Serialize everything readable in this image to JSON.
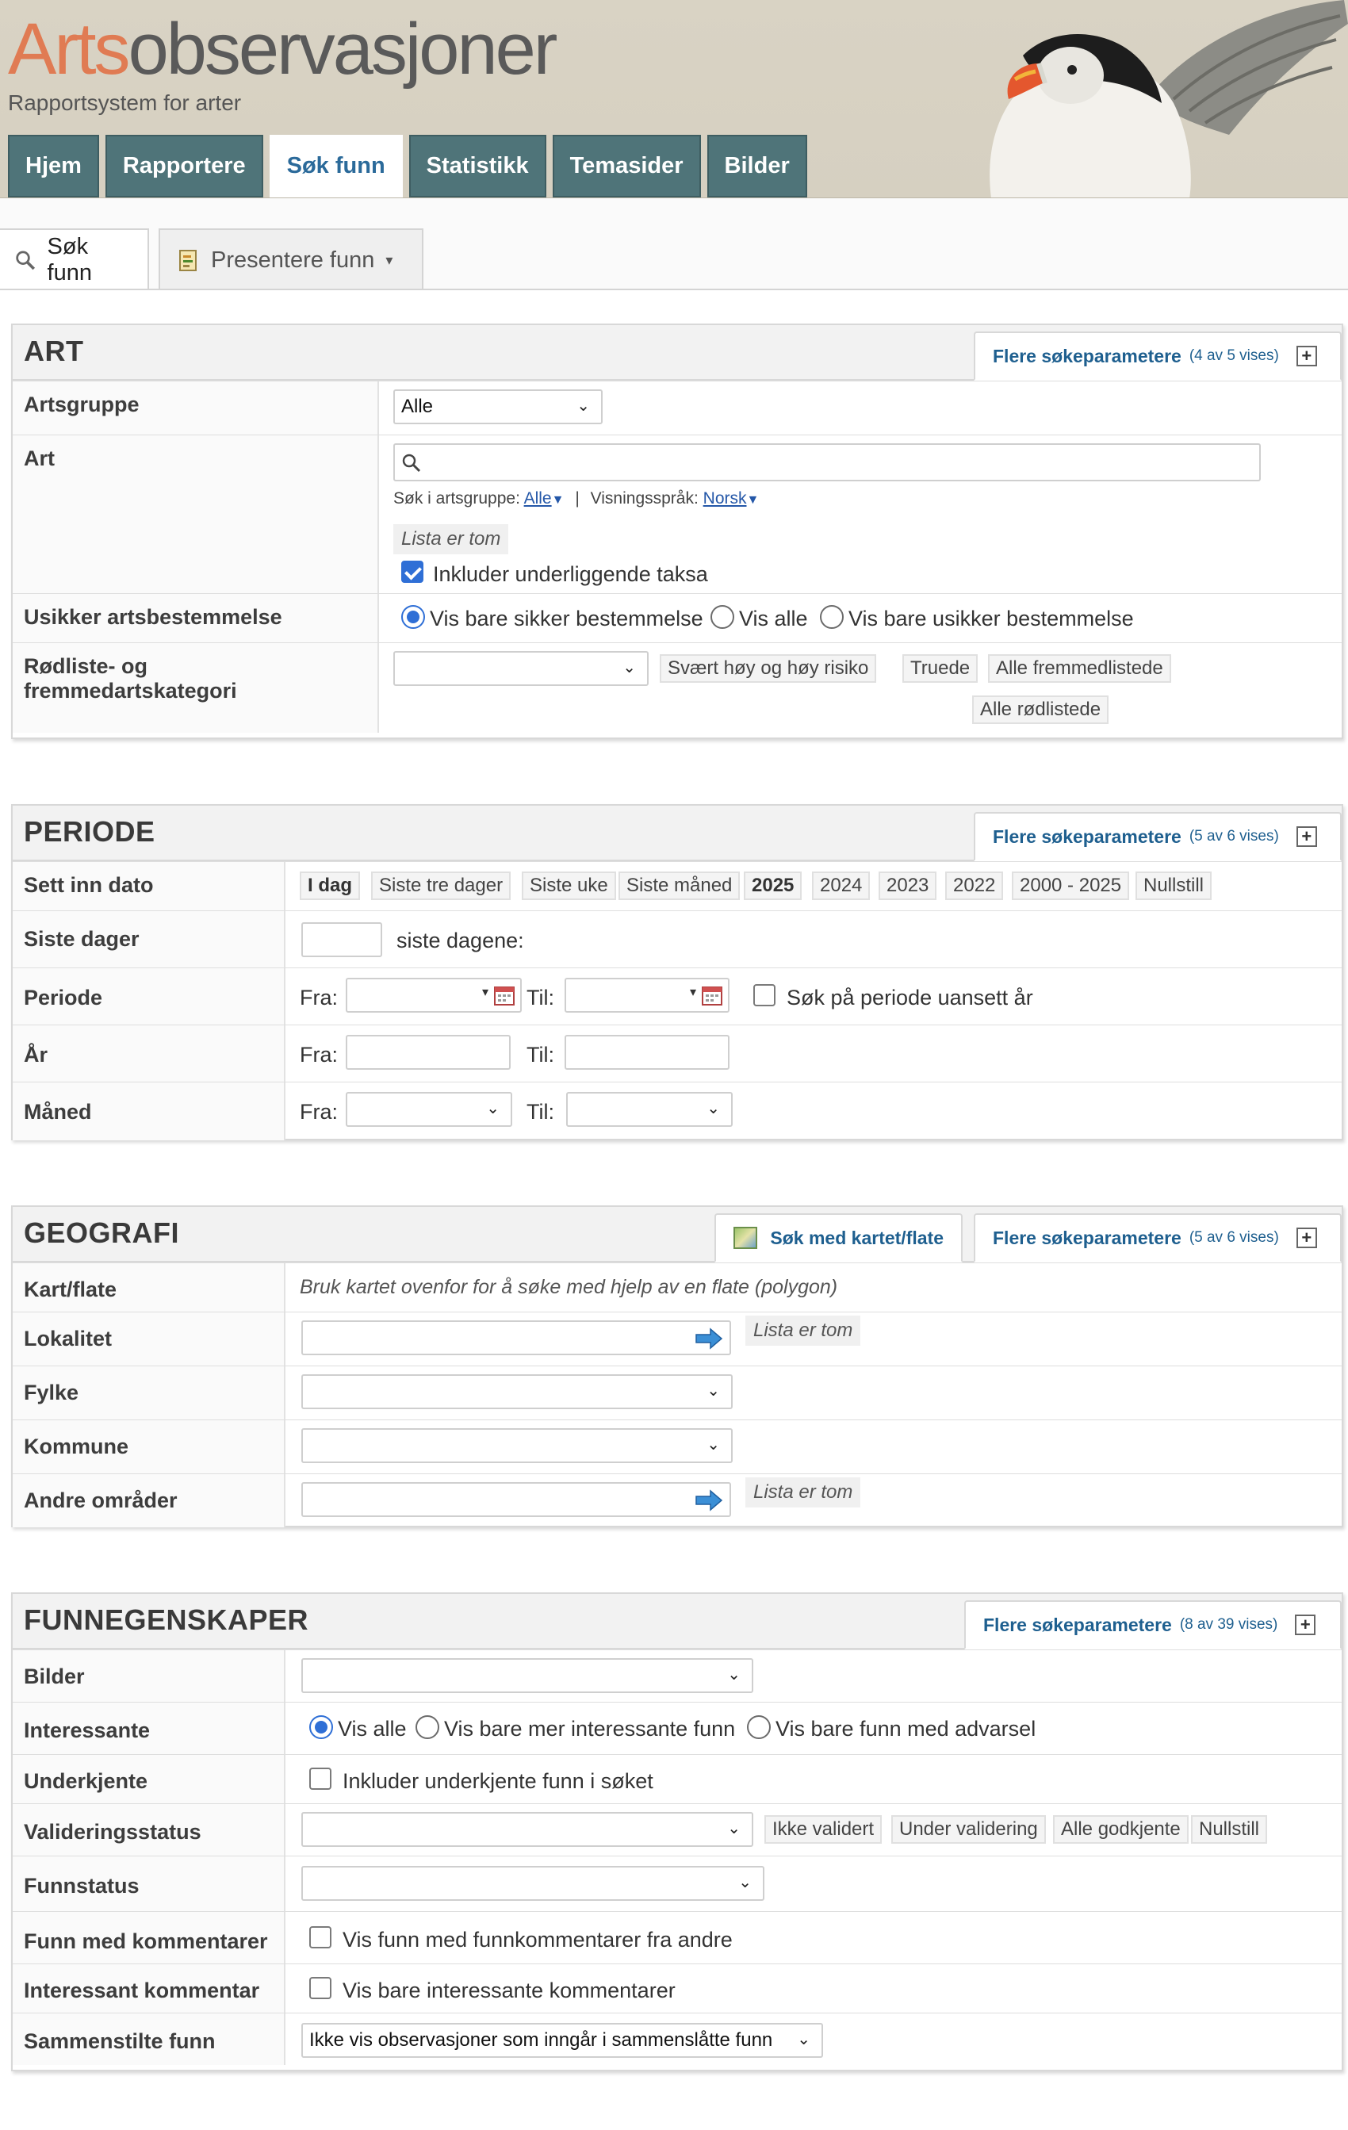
{
  "header": {
    "logo_arts": "Arts",
    "logo_obs": "observasjoner",
    "tagline": "Rapportsystem for arter",
    "nav": [
      "Hjem",
      "Rapportere",
      "Søk funn",
      "Statistikk",
      "Temasider",
      "Bilder"
    ],
    "nav_active": "Søk funn"
  },
  "subtabs": {
    "search": "Søk funn",
    "present": "Presentere funn"
  },
  "more_params_label": "Flere søkeparametere",
  "art": {
    "title": "ART",
    "more_count": "(4 av 5 vises)",
    "artsgruppe_label": "Artsgruppe",
    "artsgruppe_value": "Alle",
    "art_label": "Art",
    "search_in_group": "Søk i artsgruppe:",
    "search_in_group_value": "Alle",
    "display_lang": "Visningsspråk:",
    "display_lang_value": "Norsk",
    "list_empty": "Lista er tom",
    "include_sub_taxa": "Inkluder underliggende taksa",
    "uncertain_label": "Usikker artsbestemmelse",
    "uncertain_options": [
      "Vis bare sikker bestemmelse",
      "Vis alle",
      "Vis bare usikker bestemmelse"
    ],
    "redlist_label": "Rødliste- og fremmedartskategori",
    "redlist_chips": [
      "Svært høy og høy risiko",
      "Truede",
      "Alle fremmedlistede",
      "Alle rødlistede"
    ]
  },
  "periode": {
    "title": "PERIODE",
    "more_count": "(5 av 6 vises)",
    "sett_inn_label": "Sett inn dato",
    "date_chips": [
      "I dag",
      "Siste tre dager",
      "Siste uke",
      "Siste måned",
      "2025",
      "2024",
      "2023",
      "2022",
      "2000 - 2025",
      "Nullstill"
    ],
    "siste_dager_label": "Siste dager",
    "siste_dagene": "siste dagene:",
    "periode_label": "Periode",
    "fra": "Fra:",
    "til": "Til:",
    "any_year": "Søk på periode uansett år",
    "ar_label": "År",
    "maned_label": "Måned"
  },
  "geografi": {
    "title": "GEOGRAFI",
    "map_search": "Søk med kartet/flate",
    "more_count": "(5 av 6 vises)",
    "kart_label": "Kart/flate",
    "kart_hint": "Bruk kartet ovenfor for å søke med hjelp av en flate (polygon)",
    "lokalitet_label": "Lokalitet",
    "list_empty": "Lista er tom",
    "fylke_label": "Fylke",
    "kommune_label": "Kommune",
    "andre_label": "Andre områder"
  },
  "funn": {
    "title": "FUNNEGENSKAPER",
    "more_count": "(8 av 39 vises)",
    "bilder_label": "Bilder",
    "interessante_label": "Interessante",
    "interessante_options": [
      "Vis alle",
      "Vis bare mer interessante funn",
      "Vis bare funn med advarsel"
    ],
    "underkjente_label": "Underkjente",
    "underkjente_text": "Inkluder underkjente funn i søket",
    "validering_label": "Valideringsstatus",
    "validering_chips": [
      "Ikke validert",
      "Under validering",
      "Alle godkjente",
      "Nullstill"
    ],
    "funnstatus_label": "Funnstatus",
    "kommentarer_label": "Funn med kommentarer",
    "kommentarer_text": "Vis funn med funnkommentarer fra andre",
    "interessant_komm_label": "Interessant kommentar",
    "interessant_komm_text": "Vis bare interessante kommentarer",
    "sammenstilte_label": "Sammenstilte funn",
    "sammenstilte_value": "Ikke vis observasjoner som inngår i sammenslåtte funn"
  }
}
